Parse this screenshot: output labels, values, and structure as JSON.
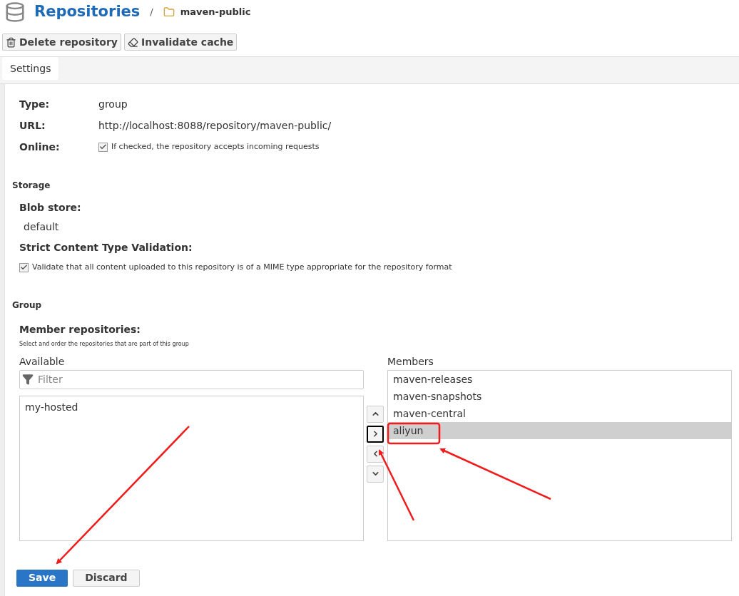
{
  "breadcrumb": {
    "title": "Repositories",
    "separator": "/",
    "current": "maven-public"
  },
  "toolbar": [
    "Delete repository",
    "Invalidate cache"
  ],
  "tabs": [
    {
      "label": "Settings",
      "selected": true
    }
  ],
  "fields": [
    {
      "label": "Type:",
      "value": "group",
      "kind": "text"
    },
    {
      "label": "URL:",
      "value": "http://localhost:8088/repository/maven-public/",
      "kind": "text"
    },
    {
      "label": "Online:",
      "value": "If checked, the repository accepts incoming requests",
      "kind": "checkbox",
      "checked": true
    }
  ],
  "storage": {
    "heading": "Storage",
    "blob_label": "Blob store:",
    "blob_value": "default",
    "validation_label": "Strict Content Type Validation:",
    "validation_text": "Validate that all content uploaded to this repository is of a MIME type appropriate for the repository format",
    "validation_checked": true
  },
  "group": {
    "heading": "Group",
    "label": "Member repositories:",
    "help": "Select and order the repositories that are part of this group",
    "available_label": "Available",
    "filter_placeholder": "Filter",
    "available": [
      {
        "name": "my-hosted",
        "selected": false
      }
    ],
    "members_label": "Members",
    "members": [
      {
        "name": "maven-releases",
        "selected": false
      },
      {
        "name": "maven-snapshots",
        "selected": false
      },
      {
        "name": "maven-central",
        "selected": false
      },
      {
        "name": "aliyun",
        "selected": true
      }
    ],
    "move_buttons": [
      {
        "kind": "up",
        "focused": false
      },
      {
        "kind": "add",
        "focused": true
      },
      {
        "kind": "remove",
        "focused": false
      },
      {
        "kind": "down",
        "focused": false
      }
    ]
  },
  "actions": [
    {
      "label": "Save",
      "kind": "primary"
    },
    {
      "label": "Discard",
      "kind": "secondary"
    }
  ]
}
